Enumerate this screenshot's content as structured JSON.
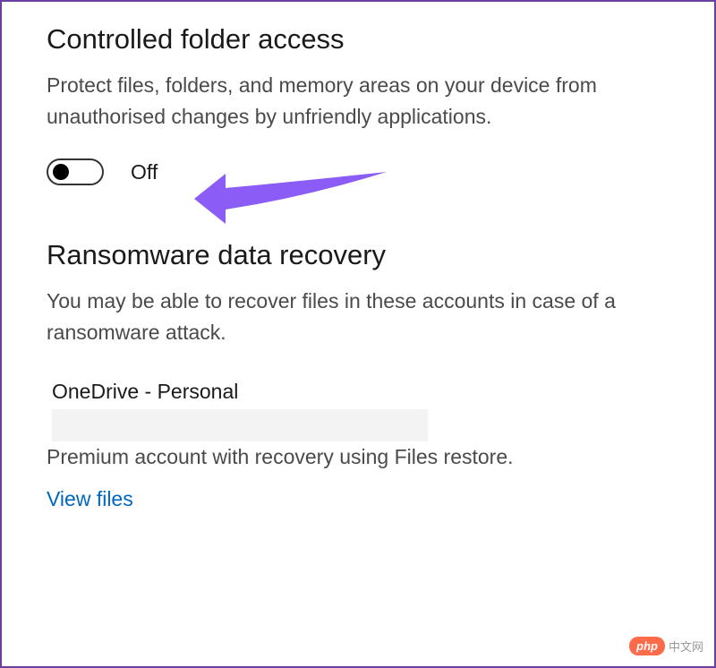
{
  "section1": {
    "title": "Controlled folder access",
    "description": "Protect files, folders, and memory areas on your device from unauthorised changes by unfriendly applications.",
    "toggle": {
      "state": "off",
      "label": "Off"
    }
  },
  "section2": {
    "title": "Ransomware data recovery",
    "description": "You may be able to recover files in these accounts in case of a ransomware attack.",
    "account": {
      "name": "OneDrive - Personal",
      "description": "Premium account with recovery using Files restore.",
      "link": "View files"
    }
  },
  "watermark": {
    "badge": "php",
    "text": "中文网"
  },
  "annotation": {
    "arrow_color": "#8b5cf6"
  }
}
